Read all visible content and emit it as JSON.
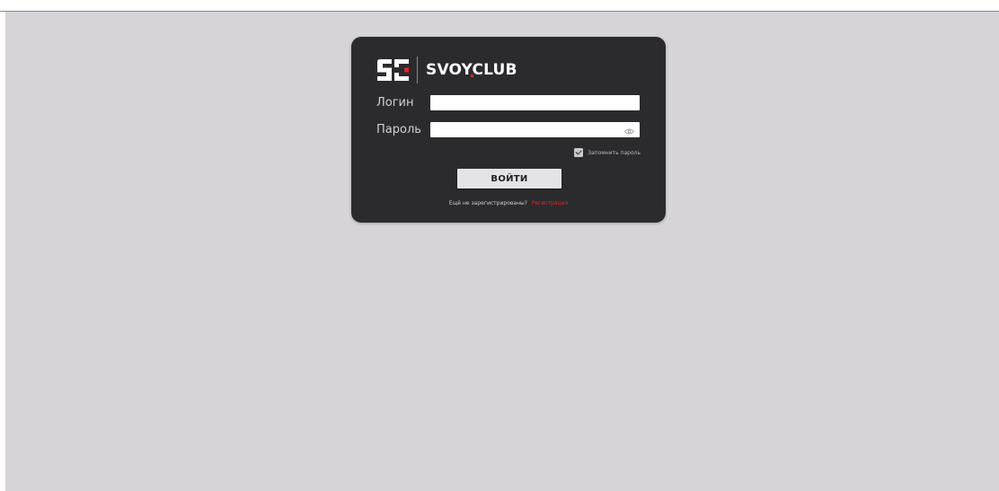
{
  "brand": {
    "mark": "SC",
    "name": "SVOYCLUB",
    "accent_color": "#e3232a"
  },
  "login_form": {
    "login_label": "Логин",
    "login_value": "",
    "password_label": "Пароль",
    "password_value": "",
    "show_password_icon": "eye-icon",
    "remember_checked": true,
    "remember_label": "Запомнить пароль",
    "submit_label": "ВОЙТИ"
  },
  "register": {
    "question": "Ещё не зарегистрированы?",
    "link_label": "Регистрация"
  }
}
